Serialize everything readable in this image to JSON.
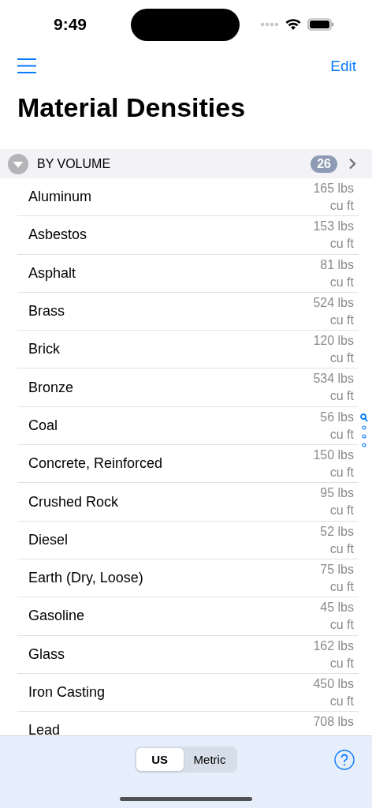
{
  "status_bar": {
    "time": "9:49"
  },
  "nav": {
    "edit": "Edit"
  },
  "title": "Material Densities",
  "section": {
    "label": "BY VOLUME",
    "count": "26",
    "expanded": true
  },
  "rows": [
    {
      "name": "Aluminum",
      "value": "165 lbs",
      "unit": "cu ft"
    },
    {
      "name": "Asbestos",
      "value": "153 lbs",
      "unit": "cu ft"
    },
    {
      "name": "Asphalt",
      "value": "81 lbs",
      "unit": "cu ft"
    },
    {
      "name": "Brass",
      "value": "524 lbs",
      "unit": "cu ft"
    },
    {
      "name": "Brick",
      "value": "120 lbs",
      "unit": "cu ft"
    },
    {
      "name": "Bronze",
      "value": "534 lbs",
      "unit": "cu ft"
    },
    {
      "name": "Coal",
      "value": "56 lbs",
      "unit": "cu ft"
    },
    {
      "name": "Concrete, Reinforced",
      "value": "150 lbs",
      "unit": "cu ft"
    },
    {
      "name": "Crushed Rock",
      "value": "95 lbs",
      "unit": "cu ft"
    },
    {
      "name": "Diesel",
      "value": "52 lbs",
      "unit": "cu ft"
    },
    {
      "name": "Earth (Dry, Loose)",
      "value": "75 lbs",
      "unit": "cu ft"
    },
    {
      "name": "Gasoline",
      "value": "45 lbs",
      "unit": "cu ft"
    },
    {
      "name": "Glass",
      "value": "162 lbs",
      "unit": "cu ft"
    },
    {
      "name": "Iron Casting",
      "value": "450 lbs",
      "unit": "cu ft"
    },
    {
      "name": "Lead",
      "value": "708 lbs"
    }
  ],
  "units": [
    {
      "label": "US",
      "selected": true
    },
    {
      "label": "Metric",
      "selected": false
    }
  ]
}
